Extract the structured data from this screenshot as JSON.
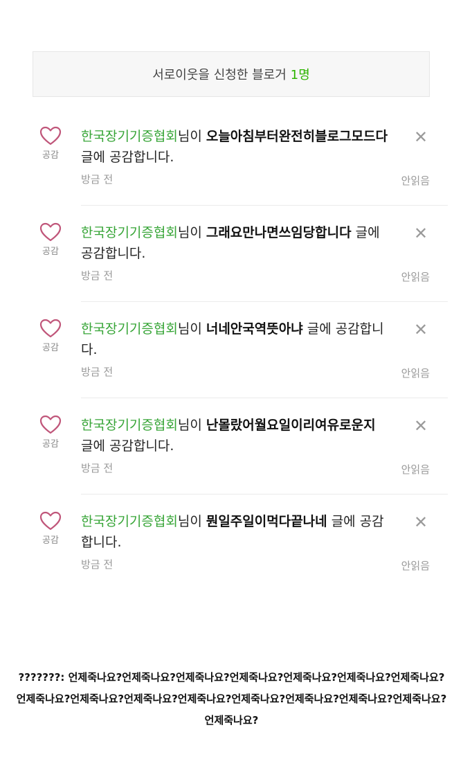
{
  "banner": {
    "text": "서로이웃을 신청한 블로거",
    "count": "1명"
  },
  "heart_label": "공감",
  "items": [
    {
      "nick": "한국장기기증협회",
      "suffix": "님이 ",
      "title": "오늘아침부터완전히블로그모드다",
      "tail": " 글에 공감합니다.",
      "time": "방금 전",
      "unread": "안읽음",
      "icon": "close-icon"
    },
    {
      "nick": "한국장기기증협회",
      "suffix": "님이 ",
      "title": "그래요만나면쓰임당합니다",
      "tail": " 글에 공감합니다.",
      "time": "방금 전",
      "unread": "안읽음",
      "icon": "close-icon"
    },
    {
      "nick": "한국장기기증협회",
      "suffix": "님이 ",
      "title": "너네안국역뜻아냐",
      "tail": " 글에 공감합니다.",
      "time": "방금 전",
      "unread": "안읽음",
      "icon": "close-icon"
    },
    {
      "nick": "한국장기기증협회",
      "suffix": "님이 ",
      "title": "난몰랐어월요일이리여유로운지",
      "tail": " 글에 공감합니다.",
      "time": "방금 전",
      "unread": "안읽음",
      "icon": "close-icon"
    },
    {
      "nick": "한국장기기증협회",
      "suffix": "님이 ",
      "title": "뭔일주일이먹다끝나네",
      "tail": " 글에 공감합니다.",
      "time": "방금 전",
      "unread": "안읽음",
      "icon": "close-icon"
    }
  ],
  "close_glyph": "✕",
  "caption": "???????: 언제죽나요?언제죽나요?언제죽나요?언제죽나요?언제죽나요?언제죽나요?언제죽나요?언제죽나요?언제죽나요?언제죽나요?언제죽나요?언제죽나요?언제죽나요?언제죽나요?언제죽나요?언제죽나요?",
  "colors": {
    "nick": "#37a537",
    "heart": "#c0567a",
    "count": "#2db400"
  }
}
